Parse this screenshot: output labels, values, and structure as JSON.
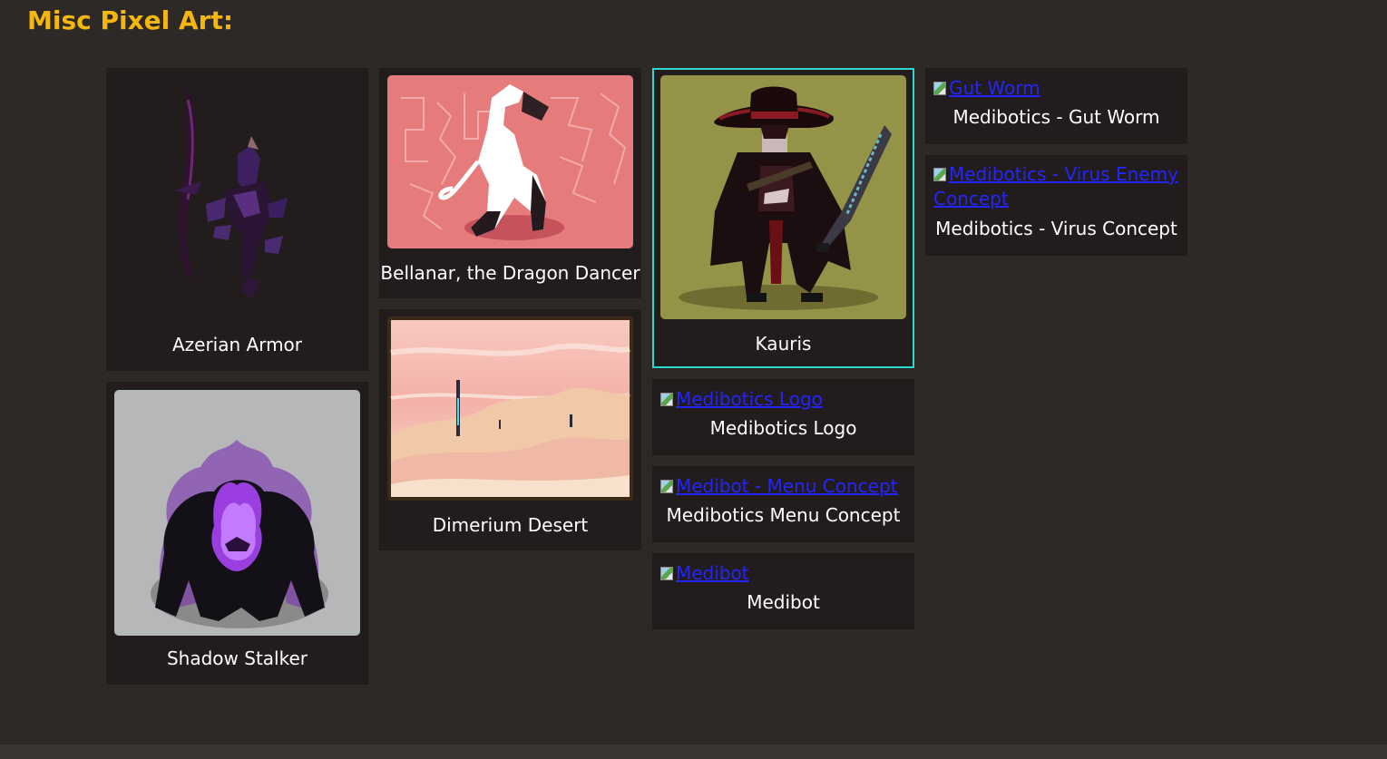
{
  "page": {
    "title": "Misc Pixel Art:"
  },
  "colors": {
    "background": "#2d2927",
    "card": "#221d1c",
    "heading": "#f5b610",
    "selected_border": "#2ed6d0",
    "link": "#2424ff"
  },
  "gallery": {
    "azerian": {
      "caption": "Azerian Armor",
      "icon": "dark-armor-artwork"
    },
    "shadow": {
      "caption": "Shadow Stalker",
      "icon": "shadow-creature-artwork"
    },
    "bellanar": {
      "caption": "Bellanar, the Dragon Dancer",
      "icon": "dragon-dancer-artwork"
    },
    "dimerium": {
      "caption": "Dimerium Desert",
      "icon": "desert-landscape-artwork"
    },
    "kauris": {
      "caption": "Kauris",
      "icon": "swordsman-artwork"
    },
    "logo": {
      "alt": "Medibotics Logo",
      "caption": "Medibotics Logo"
    },
    "menu": {
      "alt": "Medibot - Menu Concept",
      "caption": "Medibotics Menu Concept"
    },
    "medibot": {
      "alt": "Medibot",
      "caption": "Medibot"
    },
    "gutworm": {
      "alt": "Gut Worm",
      "caption": "Medibotics - Gut Worm"
    },
    "virus": {
      "alt_line1": "Medibotics - Virus Enemy",
      "alt_line2": "Concept",
      "caption": "Medibotics - Virus Concept"
    }
  }
}
